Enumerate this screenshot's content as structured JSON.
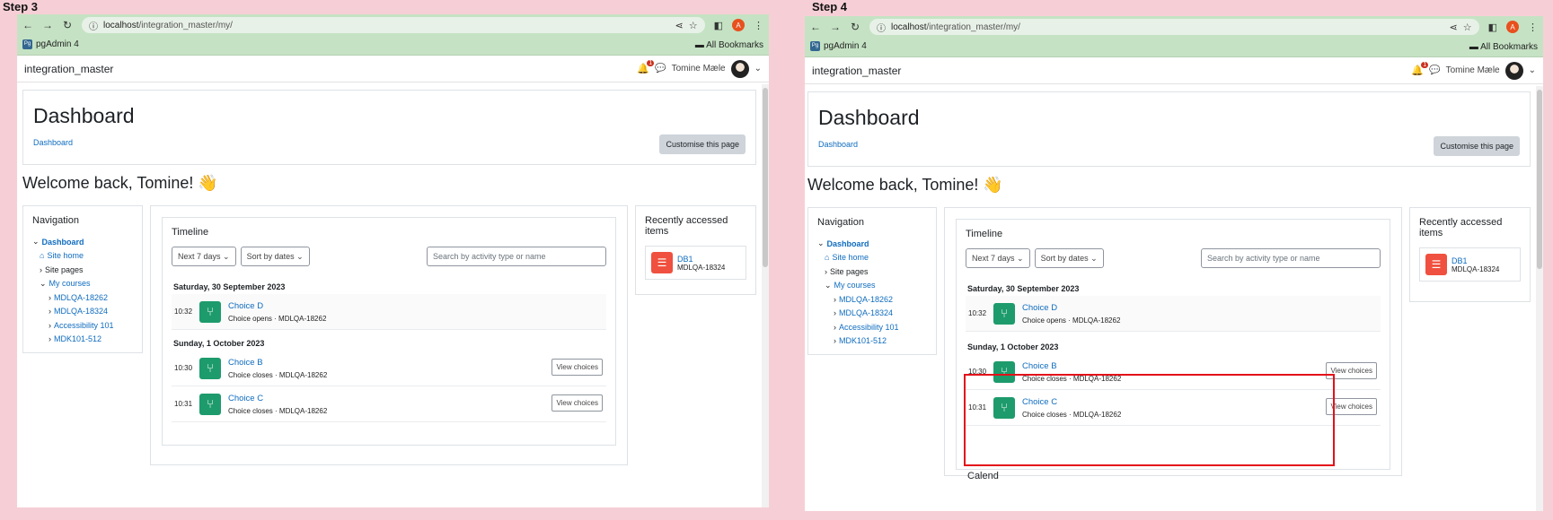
{
  "steps": [
    {
      "label": "Step 3",
      "browser": {
        "url_host": "localhost",
        "url_path": "/integration_master/my/",
        "bookmark": "pgAdmin 4",
        "all_bookmarks": "All Bookmarks",
        "profile_initial": "A"
      },
      "site": {
        "name": "integration_master",
        "notification_count": "1",
        "user_name": "Tomine Mæle"
      },
      "header": {
        "title": "Dashboard",
        "breadcrumb": "Dashboard",
        "customise_label": "Customise this page"
      },
      "welcome": "Welcome back, Tomine! 👋",
      "navigation": {
        "title": "Navigation",
        "items": [
          "Dashboard",
          "Site home",
          "Site pages",
          "My courses",
          "MDLQA-18262",
          "MDLQA-18324",
          "Accessibility 101",
          "MDK101-512"
        ]
      },
      "timeline": {
        "title": "Timeline",
        "filter_days": "Next 7 days",
        "filter_sort": "Sort by dates",
        "search_placeholder": "Search by activity type or name",
        "days": [
          {
            "date": "Saturday, 30 September 2023",
            "events": [
              {
                "time": "10:32",
                "name": "Choice D",
                "sub": "Choice opens · MDLQA-18262",
                "action": ""
              }
            ]
          },
          {
            "date": "Sunday, 1 October 2023",
            "events": [
              {
                "time": "10:30",
                "name": "Choice B",
                "sub": "Choice closes · MDLQA-18262",
                "action": "View choices"
              },
              {
                "time": "10:31",
                "name": "Choice C",
                "sub": "Choice closes · MDLQA-18262",
                "action": "View choices"
              }
            ]
          }
        ]
      },
      "recent": {
        "title": "Recently accessed items",
        "item_name": "DB1",
        "item_sub": "MDLQA-18324"
      }
    },
    {
      "label": "Step 4",
      "browser": {
        "url_host": "localhost",
        "url_path": "/integration_master/my/",
        "bookmark": "pgAdmin 4",
        "all_bookmarks": "All Bookmarks",
        "profile_initial": "A"
      },
      "site": {
        "name": "integration_master",
        "notification_count": "1",
        "user_name": "Tomine Mæle"
      },
      "header": {
        "title": "Dashboard",
        "breadcrumb": "Dashboard",
        "customise_label": "Customise this page"
      },
      "welcome": "Welcome back, Tomine! 👋",
      "navigation": {
        "title": "Navigation",
        "items": [
          "Dashboard",
          "Site home",
          "Site pages",
          "My courses",
          "MDLQA-18262",
          "MDLQA-18324",
          "Accessibility 101",
          "MDK101-512"
        ]
      },
      "timeline": {
        "title": "Timeline",
        "filter_days": "Next 7 days",
        "filter_sort": "Sort by dates",
        "search_placeholder": "Search by activity type or name",
        "days": [
          {
            "date": "Saturday, 30 September 2023",
            "events": [
              {
                "time": "10:32",
                "name": "Choice D",
                "sub": "Choice opens · MDLQA-18262",
                "action": ""
              }
            ]
          },
          {
            "date": "Sunday, 1 October 2023",
            "events": [
              {
                "time": "10:30",
                "name": "Choice B",
                "sub": "Choice closes · MDLQA-18262",
                "action": "View choices"
              },
              {
                "time": "10:31",
                "name": "Choice C",
                "sub": "Choice closes · MDLQA-18262",
                "action": "View choices"
              }
            ]
          }
        ],
        "next_section_partial": "Calend"
      },
      "recent": {
        "title": "Recently accessed items",
        "item_name": "DB1",
        "item_sub": "MDLQA-18324"
      }
    }
  ]
}
